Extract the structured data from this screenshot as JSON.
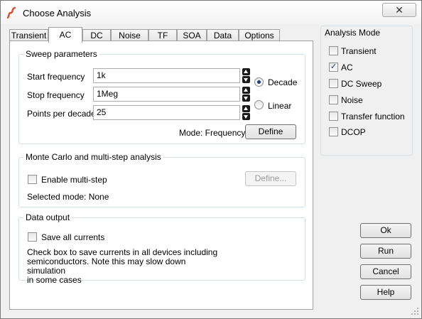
{
  "window": {
    "title": "Choose Analysis",
    "close_glyph": "✕"
  },
  "tabs": [
    {
      "label": "Transient"
    },
    {
      "label": "AC"
    },
    {
      "label": "DC"
    },
    {
      "label": "Noise"
    },
    {
      "label": "TF"
    },
    {
      "label": "SOA"
    },
    {
      "label": "Data"
    },
    {
      "label": "Options"
    }
  ],
  "active_tab": "AC",
  "sweep": {
    "title": "Sweep parameters",
    "start_label": "Start frequency",
    "start_value": "1k",
    "stop_label": "Stop frequency",
    "stop_value": "1Meg",
    "points_label": "Points per decade",
    "points_value": "25",
    "decade_label": "Decade",
    "decade_checked": true,
    "linear_label": "Linear",
    "linear_checked": false,
    "mode_text": "Mode: Frequency",
    "define_label": "Define"
  },
  "monte": {
    "title": "Monte Carlo and multi-step analysis",
    "enable_label": "Enable multi-step",
    "enable_checked": false,
    "define_label": "Define...",
    "selected_mode": "Selected mode: None"
  },
  "output": {
    "title": "Data output",
    "save_label": "Save all currents",
    "save_checked": false,
    "note_line1": "Check box to save currents in all devices including",
    "note_line2": "semiconductors. Note this may slow down simulation",
    "note_line3": "in some cases"
  },
  "analysis_mode": {
    "title": "Analysis Mode",
    "items": [
      {
        "label": "Transient",
        "checked": false
      },
      {
        "label": "AC",
        "checked": true
      },
      {
        "label": "DC Sweep",
        "checked": false
      },
      {
        "label": "Noise",
        "checked": false
      },
      {
        "label": "Transfer function",
        "checked": false
      },
      {
        "label": "DCOP",
        "checked": false
      }
    ],
    "check_glyph": "✓"
  },
  "actions": {
    "ok": "Ok",
    "run": "Run",
    "cancel": "Cancel",
    "help": "Help"
  },
  "colors": {
    "accent": "#1e3b8a",
    "app_icon": "#e0482a"
  }
}
